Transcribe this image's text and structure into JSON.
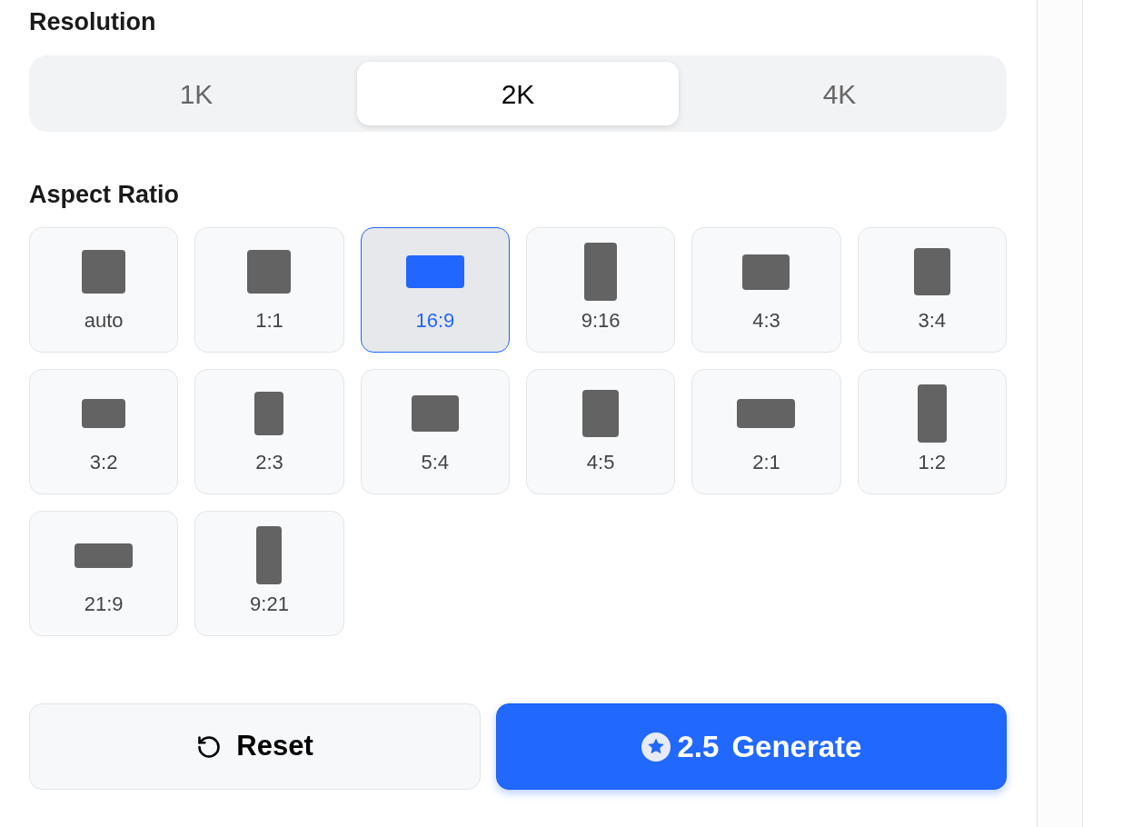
{
  "resolution": {
    "title": "Resolution",
    "options": [
      {
        "label": "1K",
        "selected": false
      },
      {
        "label": "2K",
        "selected": true
      },
      {
        "label": "4K",
        "selected": false
      }
    ]
  },
  "aspect_ratio": {
    "title": "Aspect Ratio",
    "options": [
      {
        "label": "auto",
        "selected": false
      },
      {
        "label": "1:1",
        "selected": false
      },
      {
        "label": "16:9",
        "selected": true
      },
      {
        "label": "9:16",
        "selected": false
      },
      {
        "label": "4:3",
        "selected": false
      },
      {
        "label": "3:4",
        "selected": false
      },
      {
        "label": "3:2",
        "selected": false
      },
      {
        "label": "2:3",
        "selected": false
      },
      {
        "label": "5:4",
        "selected": false
      },
      {
        "label": "4:5",
        "selected": false
      },
      {
        "label": "2:1",
        "selected": false
      },
      {
        "label": "1:2",
        "selected": false
      },
      {
        "label": "21:9",
        "selected": false
      },
      {
        "label": "9:21",
        "selected": false
      }
    ]
  },
  "actions": {
    "reset": {
      "label": "Reset"
    },
    "generate": {
      "cost": "2.5",
      "label": "Generate"
    }
  }
}
